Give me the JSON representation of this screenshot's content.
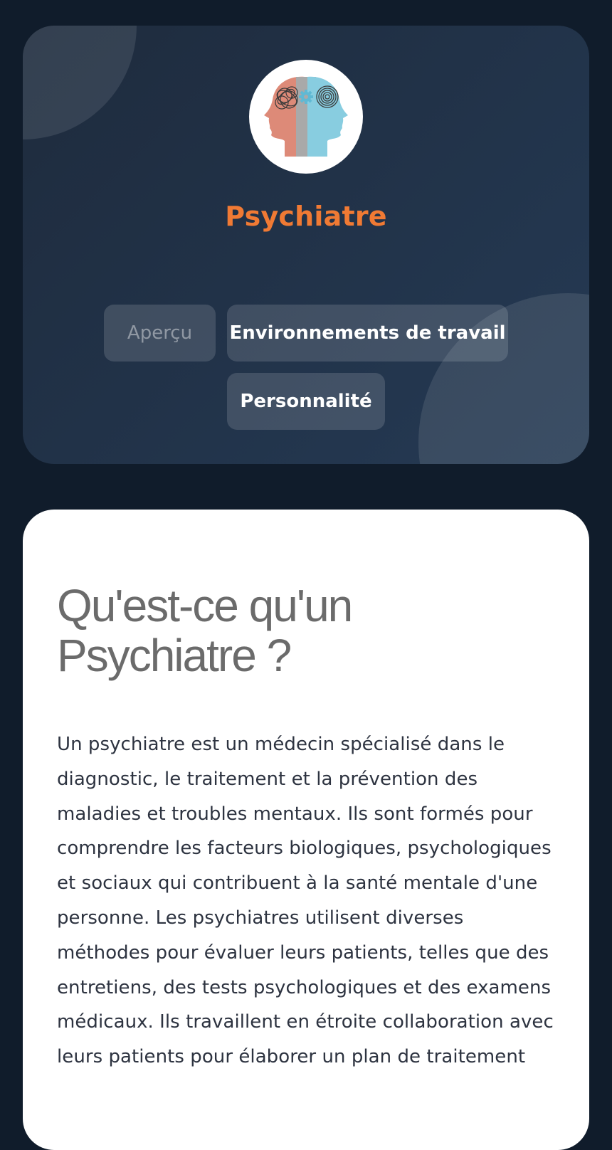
{
  "header": {
    "job_title": "Psychiatre",
    "avatar_icon": "two-heads-mind-icon",
    "colors": {
      "accent": "#f07a34",
      "background": "#101c2b"
    }
  },
  "tabs": [
    {
      "label": "Aperçu",
      "active": true
    },
    {
      "label": "Environnements de travail",
      "active": false
    },
    {
      "label": "Personnalité",
      "active": false
    }
  ],
  "content": {
    "heading": "Qu'est-ce qu'un Psychiatre ?",
    "body": "Un psychiatre est un médecin spécialisé dans le diagnostic, le traitement et la prévention des maladies et troubles mentaux. Ils sont formés pour comprendre les facteurs biologiques, psychologiques et sociaux qui contribuent à la santé mentale d'une personne. Les psychiatres utilisent diverses méthodes pour évaluer leurs patients, telles que des entretiens, des tests psychologiques et des examens médicaux. Ils travaillent en étroite collaboration avec leurs patients pour élaborer un plan de traitement"
  }
}
